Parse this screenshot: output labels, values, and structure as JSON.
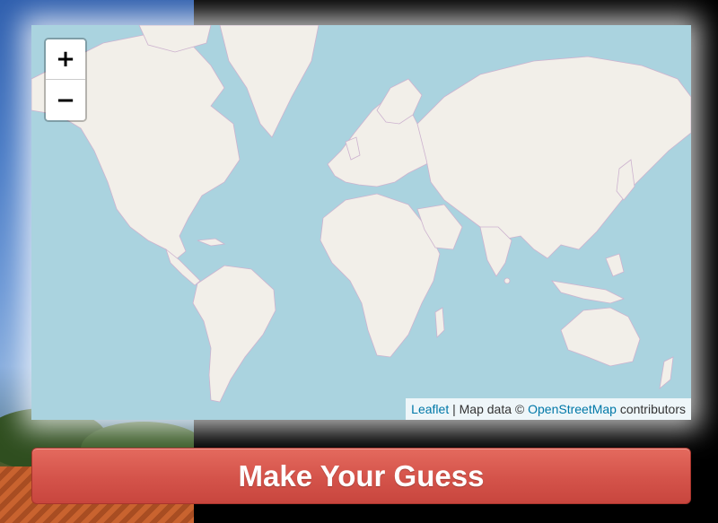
{
  "map": {
    "zoom_in_label": "+",
    "zoom_out_label": "−",
    "attribution": {
      "leaflet_link": "Leaflet",
      "separator": " | Map data © ",
      "osm_link": "OpenStreetMap",
      "suffix": " contributors"
    },
    "colors": {
      "water": "#aad3df",
      "land": "#f2efe9",
      "border": "#c8a8c8",
      "link": "#0078a8"
    }
  },
  "actions": {
    "guess_button_label": "Make Your Guess"
  },
  "colors": {
    "button": "#d4534a"
  }
}
